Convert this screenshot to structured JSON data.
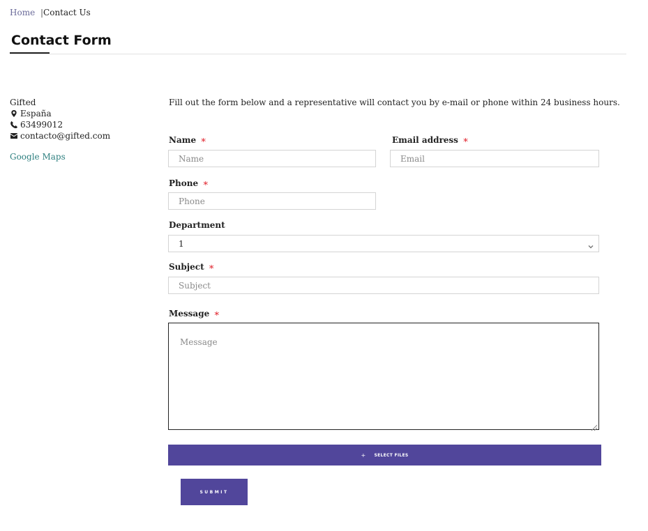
{
  "breadcrumb": {
    "home": "Home",
    "separator": "|",
    "current": "Contact Us"
  },
  "page": {
    "title": "Contact Form"
  },
  "contact": {
    "company": "Gifted",
    "location": "España",
    "phone": "63499012",
    "email": "contacto@gifted.com",
    "maps_link": "Google Maps",
    "icons": {
      "location": "map-marker-icon",
      "phone": "phone-icon",
      "email": "envelope-icon"
    }
  },
  "form": {
    "intro": "Fill out the form below and a representative will contact you by e-mail or phone within 24 business hours.",
    "required_marker": "∗",
    "name": {
      "label": "Name",
      "placeholder": "Name",
      "value": ""
    },
    "email": {
      "label": "Email address",
      "placeholder": "Email",
      "value": ""
    },
    "phone": {
      "label": "Phone",
      "placeholder": "Phone",
      "value": ""
    },
    "department": {
      "label": "Department",
      "selected": "1"
    },
    "subject": {
      "label": "Subject",
      "placeholder": "Subject",
      "value": ""
    },
    "message": {
      "label": "Message",
      "placeholder": "Message",
      "value": ""
    },
    "select_files": {
      "icon": "+",
      "label": "SELECT FILES"
    },
    "submit_label": "SUBMIT"
  },
  "colors": {
    "accent": "#51469b",
    "required": "#e0202a",
    "link": "#2f8080",
    "breadcrumb_link": "#6b6b9a"
  }
}
